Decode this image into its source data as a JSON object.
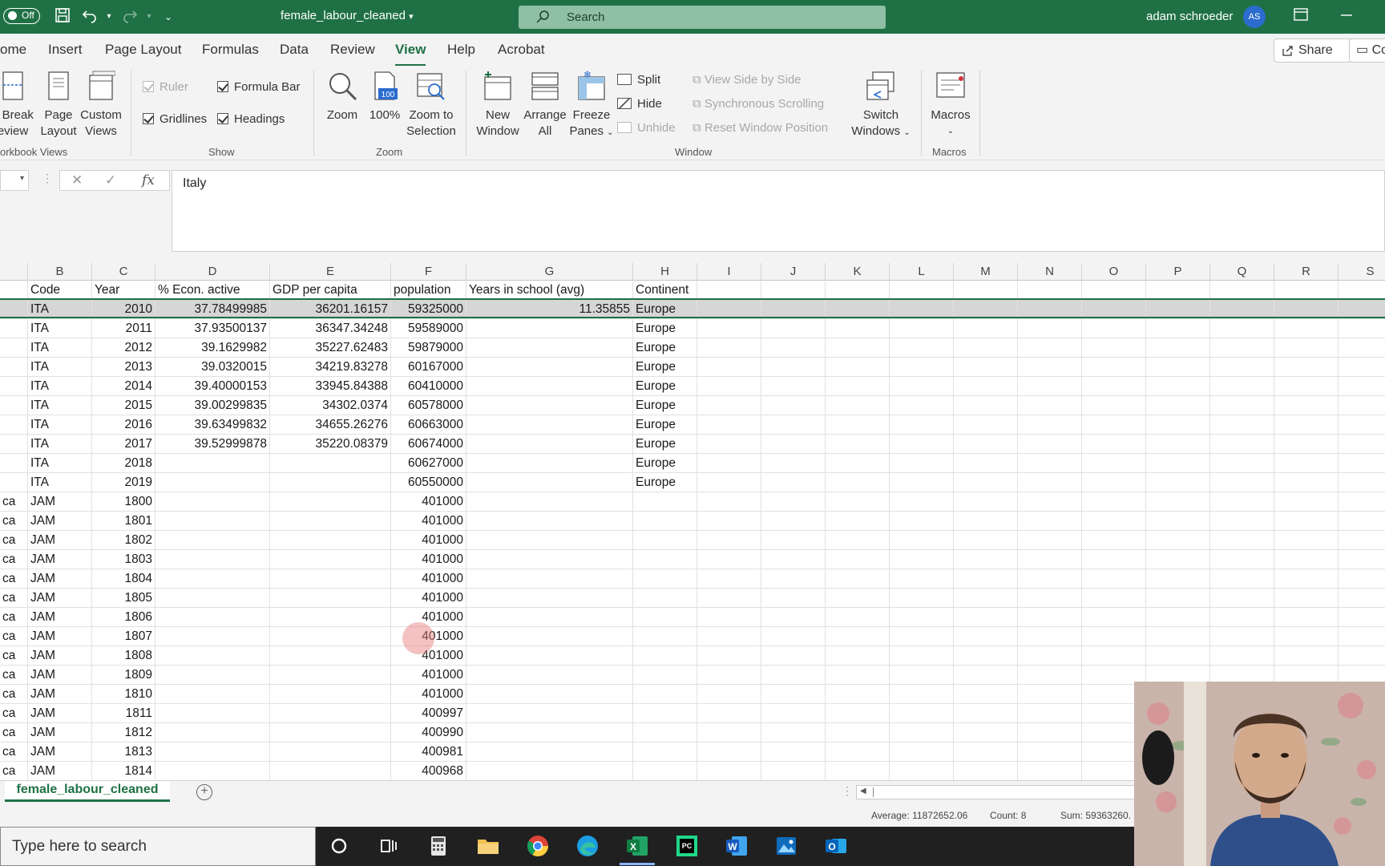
{
  "titlebar": {
    "autosave_label": "Off",
    "doc_title": "female_labour_cleaned",
    "search_placeholder": "Search",
    "user_name": "adam schroeder",
    "avatar_initials": "AS"
  },
  "menu": {
    "tabs": [
      "ome",
      "Insert",
      "Page Layout",
      "Formulas",
      "Data",
      "Review",
      "View",
      "Help",
      "Acrobat"
    ],
    "active_tab": "View",
    "share_label": "Share",
    "comments_label": "Co"
  },
  "ribbon": {
    "workbook_views": {
      "page_break_l1": "e Break",
      "page_break_l2": "eview",
      "page_layout_l1": "Page",
      "page_layout_l2": "Layout",
      "custom_views_l1": "Custom",
      "custom_views_l2": "Views",
      "group_label": "orkbook Views"
    },
    "show": {
      "ruler": "Ruler",
      "formula_bar": "Formula Bar",
      "gridlines": "Gridlines",
      "headings": "Headings",
      "group_label": "Show"
    },
    "zoom": {
      "zoom": "Zoom",
      "hundred": "100%",
      "zoom_to_sel_l1": "Zoom to",
      "zoom_to_sel_l2": "Selection",
      "group_label": "Zoom"
    },
    "window": {
      "new_window_l1": "New",
      "new_window_l2": "Window",
      "arrange_l1": "Arrange",
      "arrange_l2": "All",
      "freeze_l1": "Freeze",
      "freeze_l2": "Panes",
      "split": "Split",
      "hide": "Hide",
      "unhide": "Unhide",
      "side_by_side": "View Side by Side",
      "sync_scroll": "Synchronous Scrolling",
      "reset_pos": "Reset Window Position",
      "switch_l1": "Switch",
      "switch_l2": "Windows",
      "group_label": "Window"
    },
    "macros": {
      "macros": "Macros",
      "group_label": "Macros"
    }
  },
  "formula_bar": {
    "fx": "fx",
    "value": "Italy"
  },
  "grid": {
    "columns": [
      "",
      "B",
      "C",
      "D",
      "E",
      "F",
      "G",
      "H",
      "I",
      "J",
      "K",
      "L",
      "M",
      "N",
      "O",
      "P",
      "Q",
      "R",
      "S"
    ],
    "rows": [
      [
        "",
        "Code",
        "Year",
        "% Econ. active",
        "GDP per capita",
        "population",
        "Years in school (avg)",
        "Continent"
      ],
      [
        "",
        "ITA",
        "2010",
        "37.78499985",
        "36201.16157",
        "59325000",
        "11.35855",
        "Europe"
      ],
      [
        "",
        "ITA",
        "2011",
        "37.93500137",
        "36347.34248",
        "59589000",
        "",
        "Europe"
      ],
      [
        "",
        "ITA",
        "2012",
        "39.1629982",
        "35227.62483",
        "59879000",
        "",
        "Europe"
      ],
      [
        "",
        "ITA",
        "2013",
        "39.0320015",
        "34219.83278",
        "60167000",
        "",
        "Europe"
      ],
      [
        "",
        "ITA",
        "2014",
        "39.40000153",
        "33945.84388",
        "60410000",
        "",
        "Europe"
      ],
      [
        "",
        "ITA",
        "2015",
        "39.00299835",
        "34302.0374",
        "60578000",
        "",
        "Europe"
      ],
      [
        "",
        "ITA",
        "2016",
        "39.63499832",
        "34655.26276",
        "60663000",
        "",
        "Europe"
      ],
      [
        "",
        "ITA",
        "2017",
        "39.52999878",
        "35220.08379",
        "60674000",
        "",
        "Europe"
      ],
      [
        "",
        "ITA",
        "2018",
        "",
        "",
        "60627000",
        "",
        "Europe"
      ],
      [
        "",
        "ITA",
        "2019",
        "",
        "",
        "60550000",
        "",
        "Europe"
      ],
      [
        "ca",
        "JAM",
        "1800",
        "",
        "",
        "401000",
        "",
        ""
      ],
      [
        "ca",
        "JAM",
        "1801",
        "",
        "",
        "401000",
        "",
        ""
      ],
      [
        "ca",
        "JAM",
        "1802",
        "",
        "",
        "401000",
        "",
        ""
      ],
      [
        "ca",
        "JAM",
        "1803",
        "",
        "",
        "401000",
        "",
        ""
      ],
      [
        "ca",
        "JAM",
        "1804",
        "",
        "",
        "401000",
        "",
        ""
      ],
      [
        "ca",
        "JAM",
        "1805",
        "",
        "",
        "401000",
        "",
        ""
      ],
      [
        "ca",
        "JAM",
        "1806",
        "",
        "",
        "401000",
        "",
        ""
      ],
      [
        "ca",
        "JAM",
        "1807",
        "",
        "",
        "401000",
        "",
        ""
      ],
      [
        "ca",
        "JAM",
        "1808",
        "",
        "",
        "401000",
        "",
        ""
      ],
      [
        "ca",
        "JAM",
        "1809",
        "",
        "",
        "401000",
        "",
        ""
      ],
      [
        "ca",
        "JAM",
        "1810",
        "",
        "",
        "401000",
        "",
        ""
      ],
      [
        "ca",
        "JAM",
        "1811",
        "",
        "",
        "400997",
        "",
        ""
      ],
      [
        "ca",
        "JAM",
        "1812",
        "",
        "",
        "400990",
        "",
        ""
      ],
      [
        "ca",
        "JAM",
        "1813",
        "",
        "",
        "400981",
        "",
        ""
      ],
      [
        "ca",
        "JAM",
        "1814",
        "",
        "",
        "400968",
        "",
        ""
      ]
    ]
  },
  "sheet": {
    "tab_name": "female_labour_cleaned"
  },
  "status": {
    "average": "Average: 11872652.06",
    "count": "Count: 8",
    "sum": "Sum: 59363260."
  },
  "taskbar": {
    "search_placeholder": "Type here to search",
    "apps": [
      "cortana-icon",
      "task-view-icon",
      "calculator-icon",
      "file-explorer-icon",
      "chrome-icon",
      "edge-icon",
      "excel-icon",
      "pycharm-icon",
      "word-icon",
      "photos-icon",
      "outlook-icon"
    ]
  },
  "colors": {
    "excel_green": "#1f7145",
    "ribbon_bg": "#f3f3f3",
    "selected_row": "#d6d6d6"
  }
}
